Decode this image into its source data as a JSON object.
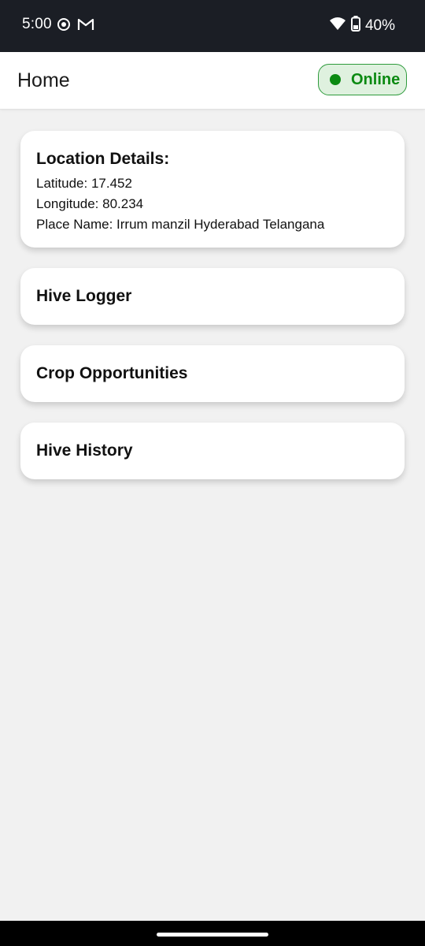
{
  "status_bar": {
    "time": "5:00",
    "battery": "40%",
    "icons": [
      "record-icon",
      "gmail-icon",
      "wifi-icon",
      "battery-icon"
    ]
  },
  "header": {
    "title": "Home",
    "status_badge": "Online"
  },
  "location": {
    "title": "Location Details:",
    "latitude": "Latitude: 17.452",
    "longitude": "Longitude: 80.234",
    "place": "Place Name: Irrum manzil Hyderabad Telangana"
  },
  "menu": [
    {
      "label": "Hive Logger"
    },
    {
      "label": "Crop Opportunities"
    },
    {
      "label": "Hive History"
    }
  ],
  "colors": {
    "online_green": "#0b8a12",
    "online_bg": "#dff1df",
    "status_bar_bg": "#1b1e25"
  }
}
